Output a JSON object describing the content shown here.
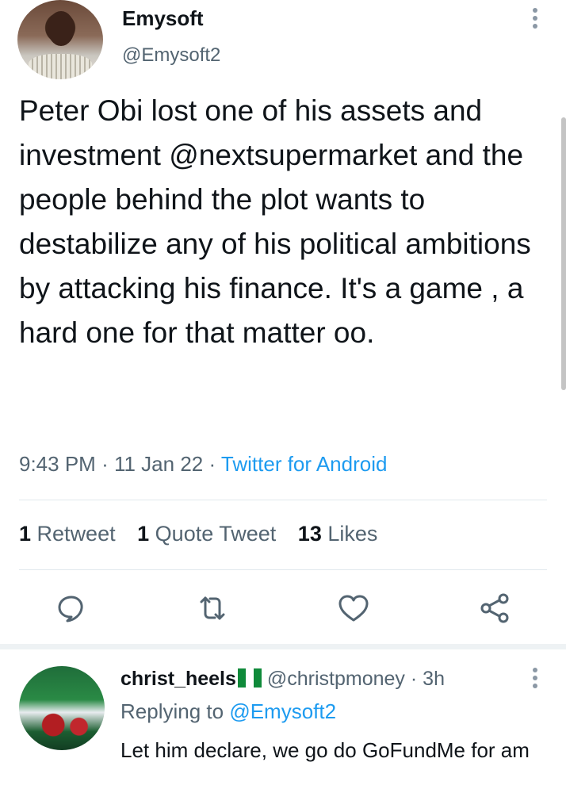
{
  "tweet": {
    "author_name": "Emysoft",
    "author_handle": "@Emysoft2",
    "text": "Peter Obi lost one of  his assets and investment @nextsupermarket and the people behind the plot wants to destabilize any of his political ambitions by attacking his finance. It's a game , a hard one for that matter oo.",
    "time": "9:43 PM",
    "date": "11 Jan 22",
    "source": "Twitter for Android",
    "separator": "·",
    "stats": {
      "retweets_count": "1",
      "retweets_label": "Retweet",
      "quotes_count": "1",
      "quotes_label": "Quote Tweet",
      "likes_count": "13",
      "likes_label": "Likes"
    }
  },
  "actions": [
    {
      "icon": "reply-icon"
    },
    {
      "icon": "retweet-icon"
    },
    {
      "icon": "like-icon"
    },
    {
      "icon": "share-icon"
    }
  ],
  "reply": {
    "author_name": "christ_heels",
    "flag": "nigeria-flag",
    "author_handle": "@christpmoney",
    "time": "3h",
    "separator": "·",
    "replying_prefix": "Replying to",
    "replying_to": "@Emysoft2",
    "text": "Let him declare, we go do GoFundMe for am"
  },
  "colors": {
    "text": "#0f1419",
    "secondary": "#536471",
    "accent": "#1d9bf0",
    "divider": "#e1e8ed"
  }
}
